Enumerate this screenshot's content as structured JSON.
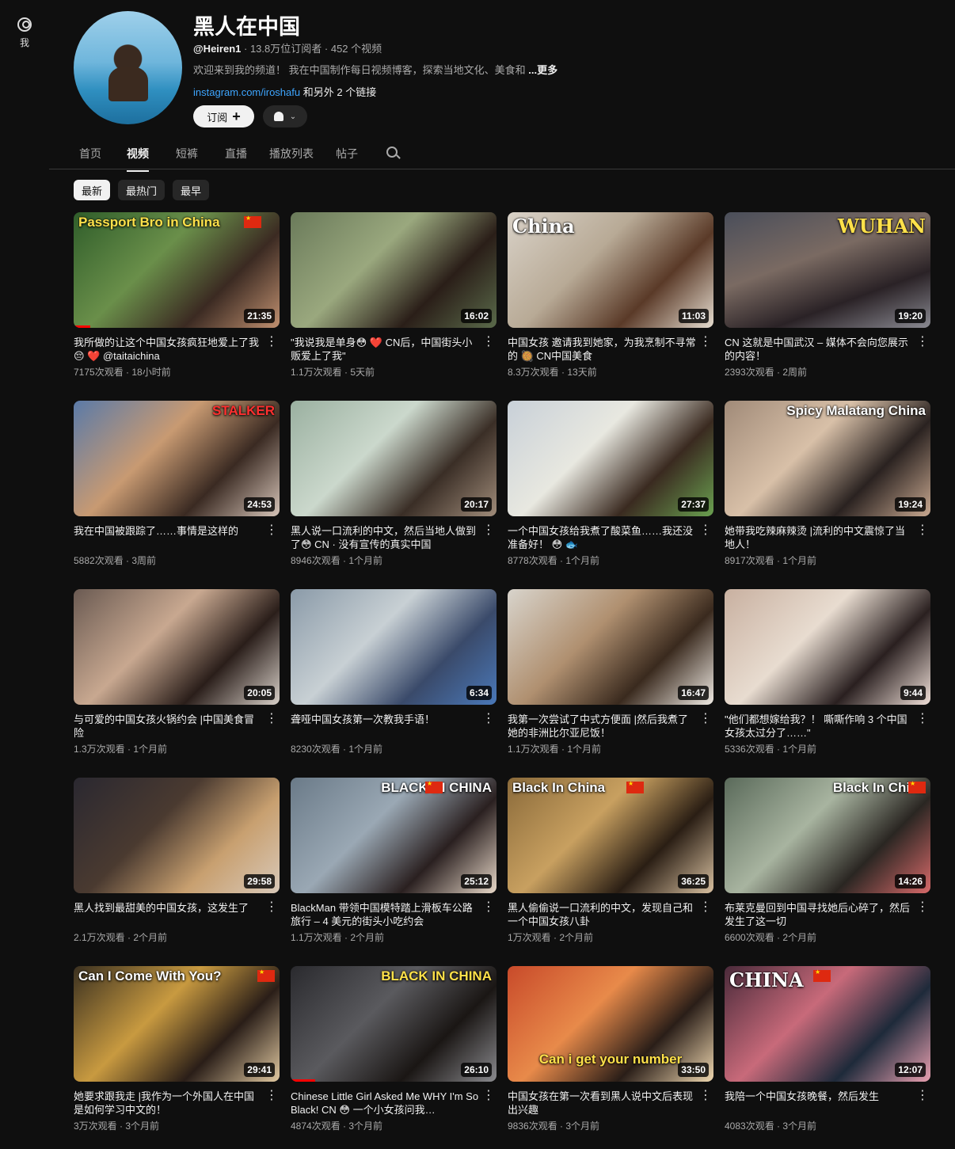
{
  "rail": {
    "profile_label": "我"
  },
  "channel": {
    "title": "黑人在中国",
    "handle": "@Heiren1",
    "subscribers": "13.8万位订阅者",
    "video_count": "452 个视频",
    "description": "欢迎来到我的频道！ 我在中国制作每日视频博客，探索当地文化、美食和",
    "more_label": "...更多",
    "link_url": "instagram.com/iroshafu",
    "link_extra": "和另外 2 个链接",
    "subscribe_label": "订阅",
    "accent": "#3ea6ff"
  },
  "tabs": [
    "首页",
    "视频",
    "短裤",
    "直播",
    "播放列表",
    "帖子"
  ],
  "active_tab": "视频",
  "chips": [
    "最新",
    "最热门",
    "最早"
  ],
  "videos": [
    {
      "overlay": "Passport Bro in China",
      "duration": "21:35",
      "title": "我所做的让这个中国女孩疯狂地爱上了我😔 ❤️ @taitaichina",
      "views": "7175次观看",
      "age": "18小时前",
      "progress": 0.08
    },
    {
      "overlay": "",
      "duration": "16:02",
      "title": "\"我说我是单身😳 ❤️ CN后，中国街头小贩爱上了我\"",
      "views": "1.1万次观看",
      "age": "5天前",
      "progress": 0
    },
    {
      "overlay": "China",
      "duration": "11:03",
      "title": "中国女孩 邀请我到她家，为我烹制不寻常的 🥘 CN中国美食",
      "views": "8.3万次观看",
      "age": "13天前",
      "progress": 0
    },
    {
      "overlay": "WUHAN",
      "duration": "19:20",
      "title": "CN 这就是中国武汉 – 媒体不会向您展示的内容！",
      "views": "2393次观看",
      "age": "2周前",
      "progress": 0
    },
    {
      "overlay": "STALKER",
      "duration": "24:53",
      "title": "我在中国被跟踪了……事情是这样的",
      "views": "5882次观看",
      "age": "3周前",
      "progress": 0
    },
    {
      "overlay": "",
      "duration": "20:17",
      "title": "黑人说一口流利的中文，然后当地人做到了😳 CN · 没有宣传的真实中国",
      "views": "8946次观看",
      "age": "1个月前",
      "progress": 0
    },
    {
      "overlay": "",
      "duration": "27:37",
      "title": "一个中国女孩给我煮了酸菜鱼……我还没准备好！ 😳 🐟",
      "views": "8778次观看",
      "age": "1个月前",
      "progress": 0
    },
    {
      "overlay": "Spicy Malatang China",
      "duration": "19:24",
      "title": "她带我吃辣麻辣烫 |流利的中文震惊了当地人！",
      "views": "8917次观看",
      "age": "1个月前",
      "progress": 0
    },
    {
      "overlay": "",
      "duration": "20:05",
      "title": "与可爱的中国女孩火锅约会 |中国美食冒险",
      "views": "1.3万次观看",
      "age": "1个月前",
      "progress": 0
    },
    {
      "overlay": "",
      "duration": "6:34",
      "title": "聋哑中国女孩第一次教我手语！",
      "views": "8230次观看",
      "age": "1个月前",
      "progress": 0
    },
    {
      "overlay": "",
      "duration": "16:47",
      "title": "我第一次尝试了中式方便面 |然后我煮了她的非洲比尔亚尼饭！",
      "views": "1.1万次观看",
      "age": "1个月前",
      "progress": 0
    },
    {
      "overlay": "",
      "duration": "9:44",
      "title": "\"他们都想嫁给我？！ 嘶嘶作响 3 个中国女孩太过分了……\"",
      "views": "5336次观看",
      "age": "1个月前",
      "progress": 0
    },
    {
      "overlay": "",
      "duration": "29:58",
      "title": "黑人找到最甜美的中国女孩，这发生了",
      "views": "2.1万次观看",
      "age": "2个月前",
      "progress": 0
    },
    {
      "overlay": "BLACK IN CHINA",
      "duration": "25:12",
      "title": "BlackMan 带领中国模特踏上滑板车公路旅行 – 4 美元的街头小吃约会",
      "views": "1.1万次观看",
      "age": "2个月前",
      "progress": 0
    },
    {
      "overlay": "Black In China",
      "duration": "36:25",
      "title": "黑人偷偷说一口流利的中文，发现自己和一个中国女孩八卦",
      "views": "1万次观看",
      "age": "2个月前",
      "progress": 0
    },
    {
      "overlay": "Black In China",
      "duration": "14:26",
      "title": "布莱克曼回到中国寻找她后心碎了，然后发生了这一切",
      "views": "6600次观看",
      "age": "2个月前",
      "progress": 0
    },
    {
      "overlay": "Can I Come With You?",
      "duration": "29:41",
      "title": "她要求跟我走 |我作为一个外国人在中国是如何学习中文的！",
      "views": "3万次观看",
      "age": "3个月前",
      "progress": 0
    },
    {
      "overlay": "BLACK IN CHINA",
      "duration": "26:10",
      "title": "Chinese Little Girl Asked Me WHY I'm So Black! CN 😳 一个小女孩问我…",
      "views": "4874次观看",
      "age": "3个月前",
      "progress": 0.12
    },
    {
      "overlay": "Can i get your number",
      "duration": "33:50",
      "title": "中国女孩在第一次看到黑人说中文后表现出兴趣",
      "views": "9836次观看",
      "age": "3个月前",
      "progress": 0
    },
    {
      "overlay": "CHINA",
      "duration": "12:07",
      "title": "我陪一个中国女孩晚餐，然后发生",
      "views": "4083次观看",
      "age": "3个月前",
      "progress": 0
    }
  ]
}
